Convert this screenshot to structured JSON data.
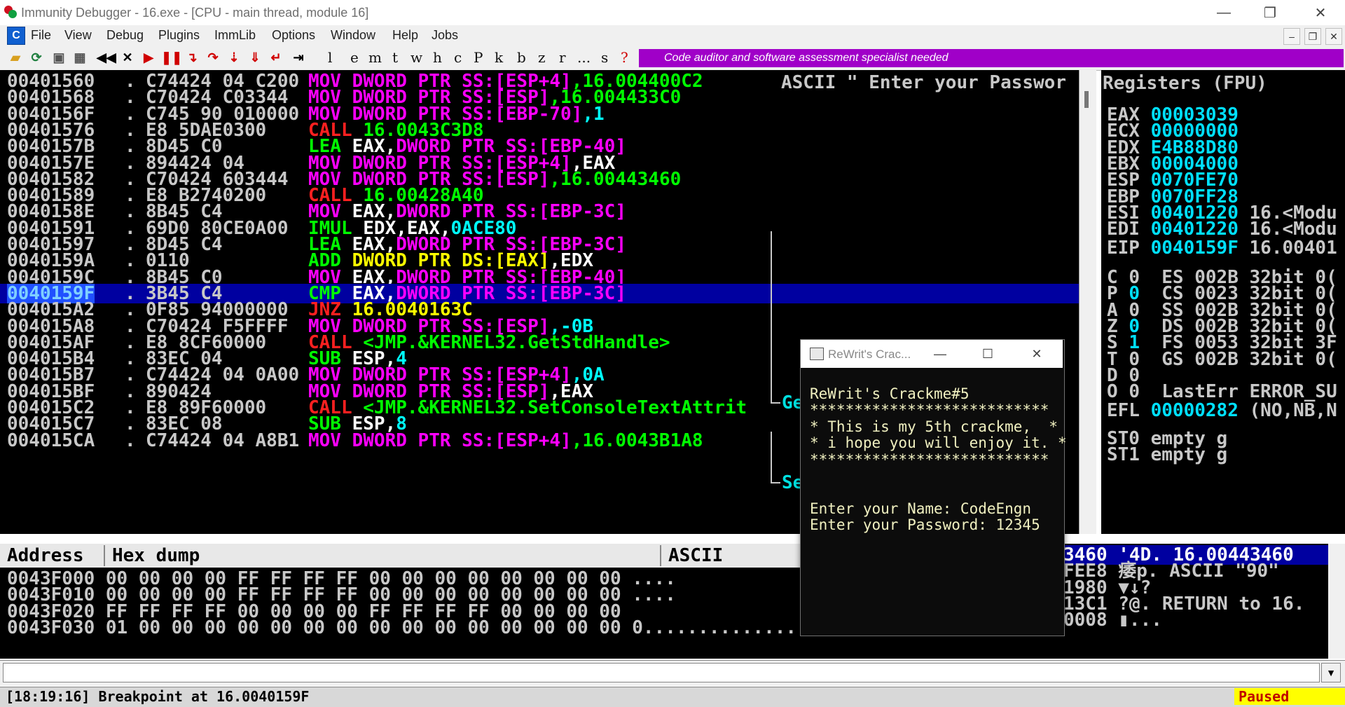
{
  "window": {
    "title": "Immunity Debugger - 16.exe - [CPU - main thread, module 16]",
    "controls": [
      "—",
      "❐",
      "✕"
    ]
  },
  "menu": {
    "items": [
      "File",
      "View",
      "Debug",
      "Plugins",
      "ImmLib",
      "Options",
      "Window",
      "Help",
      "Jobs"
    ],
    "mdi": [
      "–",
      "❐",
      "✕"
    ]
  },
  "toolbar": {
    "letters": [
      "l",
      "e",
      "m",
      "t",
      "w",
      "h",
      "c",
      "P",
      "k",
      "b",
      "z",
      "r",
      "...",
      "s",
      "?"
    ],
    "banner": "Code auditor and software assessment specialist needed"
  },
  "cpu": {
    "comment": "ASCII \" Enter your Passwor",
    "rows": [
      {
        "addr": "00401560",
        "hex": "C74424 04 C200",
        "mn": "MOV",
        "ops": [
          [
            "DWORD PTR",
            "m"
          ],
          [
            " SS:[ESP+4]",
            "m"
          ],
          [
            ",16.004400C2",
            "g"
          ]
        ]
      },
      {
        "addr": "00401568",
        "hex": "C70424 C03344",
        "mn": "MOV",
        "ops": [
          [
            "DWORD PTR",
            "m"
          ],
          [
            " SS:[ESP]",
            "m"
          ],
          [
            ",16.004433C0",
            "g"
          ]
        ]
      },
      {
        "addr": "0040156F",
        "hex": "C745 90 010000",
        "mn": "MOV",
        "ops": [
          [
            "DWORD PTR",
            "m"
          ],
          [
            " SS:[EBP-70]",
            "m"
          ],
          [
            ",1",
            "c"
          ]
        ]
      },
      {
        "addr": "00401576",
        "hex": "E8 5DAE0300",
        "mn": "CALL",
        "ops": [
          [
            "16.0043C3D8",
            "g"
          ]
        ]
      },
      {
        "addr": "0040157B",
        "hex": "8D45 C0",
        "mn": "LEA",
        "ops": [
          [
            "EAX,",
            "w"
          ],
          [
            "DWORD PTR",
            "m"
          ],
          [
            " SS:[EBP-40]",
            "m"
          ]
        ]
      },
      {
        "addr": "0040157E",
        "hex": "894424 04",
        "mn": "MOV",
        "ops": [
          [
            "DWORD PTR",
            "m"
          ],
          [
            " SS:[ESP+4]",
            "m"
          ],
          [
            ",EAX",
            "w"
          ]
        ]
      },
      {
        "addr": "00401582",
        "hex": "C70424 603444",
        "mn": "MOV",
        "ops": [
          [
            "DWORD PTR",
            "m"
          ],
          [
            " SS:[ESP]",
            "m"
          ],
          [
            ",16.00443460",
            "g"
          ]
        ]
      },
      {
        "addr": "00401589",
        "hex": "E8 B2740200",
        "mn": "CALL",
        "ops": [
          [
            "16.00428A40",
            "g"
          ]
        ]
      },
      {
        "addr": "0040158E",
        "hex": "8B45 C4",
        "mn": "MOV",
        "ops": [
          [
            "EAX,",
            "w"
          ],
          [
            "DWORD PTR",
            "m"
          ],
          [
            " SS:[EBP-3C]",
            "m"
          ]
        ]
      },
      {
        "addr": "00401591",
        "hex": "69D0 80CE0A00",
        "mn": "IMUL",
        "ops": [
          [
            "EDX,EAX,",
            "w"
          ],
          [
            "0ACE80",
            "c"
          ]
        ]
      },
      {
        "addr": "00401597",
        "hex": "8D45 C4",
        "mn": "LEA",
        "ops": [
          [
            "EAX,",
            "w"
          ],
          [
            "DWORD PTR",
            "m"
          ],
          [
            " SS:[EBP-3C]",
            "m"
          ]
        ]
      },
      {
        "addr": "0040159A",
        "hex": "0110",
        "mn": "ADD",
        "ops": [
          [
            "DWORD PTR DS:[EAX]",
            "y"
          ],
          [
            ",EDX",
            "w"
          ]
        ]
      },
      {
        "addr": "0040159C",
        "hex": "8B45 C0",
        "mn": "MOV",
        "ops": [
          [
            "EAX,",
            "w"
          ],
          [
            "DWORD PTR",
            "m"
          ],
          [
            " SS:[EBP-40]",
            "m"
          ]
        ]
      },
      {
        "addr": "0040159F",
        "hex": "3B45 C4",
        "mn": "CMP",
        "ops": [
          [
            "EAX,",
            "w"
          ],
          [
            "DWORD PTR",
            "m"
          ],
          [
            " SS:[EBP-3C]",
            "m"
          ]
        ]
      },
      {
        "addr": "004015A2",
        "hex": "0F85 94000000",
        "mn": "JNZ",
        "ops": [
          [
            "16.0040163C",
            "y"
          ]
        ]
      },
      {
        "addr": "004015A8",
        "hex": "C70424 F5FFFF",
        "mn": "MOV",
        "ops": [
          [
            "DWORD PTR",
            "m"
          ],
          [
            " SS:[ESP]",
            "m"
          ],
          [
            ",-0B",
            "c"
          ]
        ]
      },
      {
        "addr": "004015AF",
        "hex": "E8 8CF60000",
        "mn": "CALL",
        "ops": [
          [
            "<JMP.&KERNEL32.GetStdHandle>",
            "g"
          ]
        ]
      },
      {
        "addr": "004015B4",
        "hex": "83EC 04",
        "mn": "SUB",
        "ops": [
          [
            "ESP,",
            "w"
          ],
          [
            "4",
            "c"
          ]
        ]
      },
      {
        "addr": "004015B7",
        "hex": "C74424 04 0A00",
        "mn": "MOV",
        "ops": [
          [
            "DWORD PTR",
            "m"
          ],
          [
            " SS:[ESP+4]",
            "m"
          ],
          [
            ",0A",
            "c"
          ]
        ]
      },
      {
        "addr": "004015BF",
        "hex": "890424",
        "mn": "MOV",
        "ops": [
          [
            "DWORD PTR",
            "m"
          ],
          [
            " SS:[ESP]",
            "m"
          ],
          [
            ",EAX",
            "w"
          ]
        ]
      },
      {
        "addr": "004015C2",
        "hex": "E8 89F60000",
        "mn": "CALL",
        "ops": [
          [
            "<JMP.&KERNEL32.SetConsoleTextAttrit",
            "g"
          ]
        ]
      },
      {
        "addr": "004015C7",
        "hex": "83EC 08",
        "mn": "SUB",
        "ops": [
          [
            "ESP,",
            "w"
          ],
          [
            "8",
            "c"
          ]
        ]
      },
      {
        "addr": "004015CA",
        "hex": "C74424 04 A8B1",
        "mn": "MOV",
        "ops": [
          [
            "DWORD PTR",
            "m"
          ],
          [
            " SS:[ESP+4]",
            "m"
          ],
          [
            ",16.0043B1A8",
            "g"
          ]
        ]
      }
    ],
    "jump_labels": [
      "Ge",
      "Se"
    ]
  },
  "registers": {
    "header": "Registers (FPU)",
    "gp": [
      {
        "n": "EAX",
        "v": "00003039",
        "note": ""
      },
      {
        "n": "ECX",
        "v": "00000000",
        "note": ""
      },
      {
        "n": "EDX",
        "v": "E4B88D80",
        "note": ""
      },
      {
        "n": "EBX",
        "v": "00004000",
        "note": ""
      },
      {
        "n": "ESP",
        "v": "0070FE70",
        "note": ""
      },
      {
        "n": "EBP",
        "v": "0070FF28",
        "note": ""
      },
      {
        "n": "ESI",
        "v": "00401220",
        "note": "16.<Modu"
      },
      {
        "n": "EDI",
        "v": "00401220",
        "note": "16.<Modu"
      }
    ],
    "eip": {
      "n": "EIP",
      "v": "0040159F",
      "note": "16.00401"
    },
    "flags": [
      {
        "f": "C",
        "b": "0",
        "seg": "ES 002B 32bit 0("
      },
      {
        "f": "P",
        "b": "0",
        "seg": "CS 0023 32bit 0("
      },
      {
        "f": "A",
        "b": "0",
        "seg": "SS 002B 32bit 0("
      },
      {
        "f": "Z",
        "b": "0",
        "seg": "DS 002B 32bit 0("
      },
      {
        "f": "S",
        "b": "1",
        "seg": "FS 0053 32bit 3F"
      },
      {
        "f": "T",
        "b": "0",
        "seg": "GS 002B 32bit 0("
      },
      {
        "f": "D",
        "b": "0",
        "seg": ""
      },
      {
        "f": "O",
        "b": "0",
        "seg": "LastErr ERROR_SU"
      }
    ],
    "efl": {
      "n": "EFL",
      "v": "00000282",
      "note": "(NO,NB,N"
    },
    "fpu": [
      "ST0 empty g",
      "ST1 empty g"
    ]
  },
  "dump": {
    "headers": [
      "Address",
      "Hex dump",
      "ASCII"
    ],
    "rows": [
      {
        "addr": "0043F000",
        "hex": "00 00 00 00 FF FF FF FF 00 00 00 00 00 00 00 00",
        "ascii": "...."
      },
      {
        "addr": "0043F010",
        "hex": "00 00 00 00 FF FF FF FF 00 00 00 00 00 00 00 00",
        "ascii": "...."
      },
      {
        "addr": "0043F020",
        "hex": "FF FF FF FF 00 00 00 00 FF FF FF FF 00 00 00 00",
        "ascii": ""
      },
      {
        "addr": "0043F030",
        "hex": "01 00 00 00 00 00 00 00 00 00 00 00 00 00 00 00",
        "ascii": "0..............."
      }
    ]
  },
  "stack": {
    "rows": [
      {
        "a": "3460",
        "b": "'4D. 16.00443460"
      },
      {
        "a": "FEE8",
        "b": "痿p. ASCII \"90\""
      },
      {
        "a": "1980",
        "b": "▼↓?"
      },
      {
        "a": "13C1",
        "b": "?@. RETURN to 16."
      },
      {
        "a": "0008",
        "b": "▮..."
      }
    ]
  },
  "console": {
    "title": "ReWrit's Crac...",
    "lines": [
      "ReWrit's Crackme#5",
      "***************************",
      "* This is my 5th crackme,  *",
      "* i hope you will enjoy it. *",
      "***************************",
      "",
      "",
      "Enter your Name: CodeEngn",
      "Enter your Password: 12345"
    ]
  },
  "status": {
    "message": "[18:19:16] Breakpoint at 16.0040159F",
    "state": "Paused"
  },
  "colors": {
    "mov": "#ff00ff",
    "lea": "#00ff00",
    "call": "#ff2020",
    "cmp": "#00ff00",
    "jnz": "#ff2020",
    "mem": "#ff00ff",
    "const": "#00ffff",
    "addr_green": "#00ff00",
    "yellow": "#ffff00",
    "white": "#ffffff"
  }
}
